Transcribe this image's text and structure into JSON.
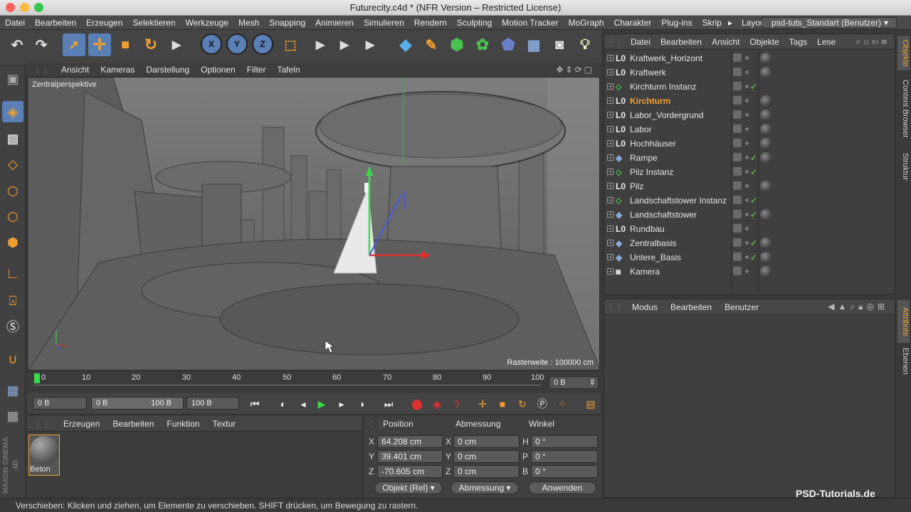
{
  "window": {
    "title": "Futurecity.c4d * (NFR Version – Restricted License)"
  },
  "menubar": {
    "items": [
      "Datei",
      "Bearbeiten",
      "Erzeugen",
      "Selektieren",
      "Werkzeuge",
      "Mesh",
      "Snapping",
      "Animieren",
      "Simulieren",
      "Rendern",
      "Sculpting",
      "Motion Tracker",
      "MoGraph",
      "Charakter",
      "Plug-ins",
      "Skrip"
    ],
    "more": "▸",
    "layout_label": "Layout:",
    "layout_value": "psd-tuts_Standart (Benutzer)"
  },
  "viewport": {
    "menu": [
      "Ansicht",
      "Kameras",
      "Darstellung",
      "Optionen",
      "Filter",
      "Tafeln"
    ],
    "camera_label": "Zentralperspektive",
    "grid_label": "Rasterweite : 100000 cm"
  },
  "timeline": {
    "ticks": [
      "0",
      "10",
      "20",
      "30",
      "40",
      "50",
      "60",
      "70",
      "80",
      "90",
      "100"
    ],
    "current_frame": "0 B"
  },
  "transport": {
    "start_field": "0 B",
    "range_min": "0 B",
    "range_max": "100 B",
    "end_field": "100 B"
  },
  "material_manager": {
    "menu": [
      "Erzeugen",
      "Bearbeiten",
      "Funktion",
      "Textur"
    ],
    "materials": [
      {
        "name": "Beton"
      }
    ]
  },
  "coordinates": {
    "headers": {
      "position": "Position",
      "size": "Abmessung",
      "rotation": "Winkel"
    },
    "position": {
      "x": "64.208 cm",
      "y": "39.401 cm",
      "z": "-70.605 cm"
    },
    "size": {
      "x": "0 cm",
      "y": "0 cm",
      "z": "0 cm"
    },
    "rotation": {
      "h": "0 °",
      "p": "0 °",
      "b": "0 °"
    },
    "axis_labels": {
      "x": "X",
      "y": "Y",
      "z": "Z",
      "h": "H",
      "p": "P",
      "b": "B"
    },
    "mode_dropdown": "Objekt (Rel)",
    "size_dropdown": "Abmessung",
    "apply_button": "Anwenden"
  },
  "object_manager": {
    "menu": [
      "Datei",
      "Bearbeiten",
      "Ansicht",
      "Objekte",
      "Tags",
      "Lese"
    ],
    "objects": [
      {
        "name": "Kraftwerk_Horizont",
        "icon": "null-icon",
        "check": "",
        "tag": true,
        "selected": false
      },
      {
        "name": "Kraftwerk",
        "icon": "null-icon",
        "check": "",
        "tag": true,
        "selected": false
      },
      {
        "name": "Kirchturm Instanz",
        "icon": "instance-icon",
        "check": "✓",
        "tag": false,
        "selected": false
      },
      {
        "name": "Kirchturm",
        "icon": "null-icon",
        "check": "",
        "tag": true,
        "selected": true
      },
      {
        "name": "Labor_Vordergrund",
        "icon": "null-icon",
        "check": "",
        "tag": true,
        "selected": false
      },
      {
        "name": "Labor",
        "icon": "null-icon",
        "check": "",
        "tag": true,
        "selected": false
      },
      {
        "name": "Hochhäuser",
        "icon": "null-icon",
        "check": "",
        "tag": true,
        "selected": false
      },
      {
        "name": "Rampe",
        "icon": "polygon-icon",
        "check": "✓",
        "tag": true,
        "selected": false
      },
      {
        "name": "Pilz Instanz",
        "icon": "instance-icon",
        "check": "✓",
        "tag": false,
        "selected": false
      },
      {
        "name": "Pilz",
        "icon": "null-icon",
        "check": "",
        "tag": true,
        "selected": false
      },
      {
        "name": "Landschaftstower Instanz",
        "icon": "instance-icon",
        "check": "✓",
        "tag": false,
        "selected": false
      },
      {
        "name": "Landschaftstower",
        "icon": "polygon-icon",
        "check": "✓",
        "tag": true,
        "selected": false
      },
      {
        "name": "Rundbau",
        "icon": "null-icon",
        "check": "",
        "tag": false,
        "selected": false
      },
      {
        "name": "Zentralbasis",
        "icon": "polygon-icon",
        "check": "✓",
        "tag": true,
        "selected": false
      },
      {
        "name": "Untere_Basis",
        "icon": "polygon-icon",
        "check": "✓",
        "tag": true,
        "selected": false
      },
      {
        "name": "Kamera",
        "icon": "camera-icon",
        "check": "",
        "tag": true,
        "selected": false
      }
    ]
  },
  "attribute_manager": {
    "menu": [
      "Modus",
      "Bearbeiten",
      "Benutzer"
    ]
  },
  "side_tabs": [
    "Objekte",
    "Content Browser",
    "Struktur",
    "Attribute",
    "Ebenen"
  ],
  "status_bar": "Verschieben: Klicken und ziehen, um Elemente zu verschieben. SHIFT drücken, um Bewegung zu rastern.",
  "watermark": "PSD-Tutorials.de",
  "branding": "MAXON CINEMA 4D",
  "colors": {
    "selected_object": "#f0a030",
    "accent_orange": "#e8922a",
    "highlight_blue": "#5a8fd0"
  }
}
